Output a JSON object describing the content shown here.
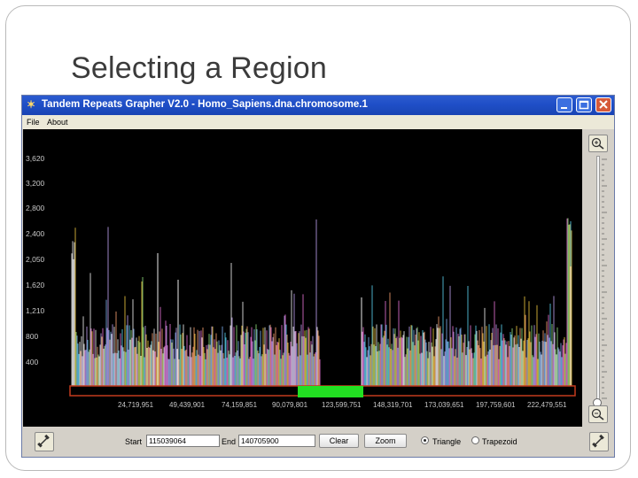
{
  "slide": {
    "title": "Selecting a Region"
  },
  "window": {
    "title": "Tandem Repeats Grapher V2.0 - Homo_Sapiens.dna.chromosome.1",
    "menu": [
      "File",
      "About"
    ]
  },
  "plot": {
    "y_ticks": [
      "3,620",
      "3,200",
      "2,800",
      "2,400",
      "2,050",
      "1,620",
      "1,210",
      "800",
      "400"
    ],
    "x_ticks": [
      "24,719,951",
      "49,439,901",
      "74,159,851",
      "90,079,801",
      "123,599,751",
      "148,319,701",
      "173,039,651",
      "197,759,601",
      "222,479,551"
    ],
    "selection_color": "#22e022",
    "baseline_color": "#c23a1e",
    "series_colors": [
      "#e8c23f",
      "#e06fd0",
      "#58c9e6",
      "#eaeaea",
      "#8fd97a",
      "#b89ae8",
      "#f09a6b",
      "#7aa8e8"
    ]
  },
  "controls": {
    "start_label": "Start",
    "start_value": "115039064",
    "end_label": "End",
    "end_value": "140705900",
    "clear_label": "Clear",
    "zoom_label": "Zoom",
    "triangle_label": "Triangle",
    "trapezoid_label": "Trapezoid",
    "selected_mode": "Triangle"
  }
}
